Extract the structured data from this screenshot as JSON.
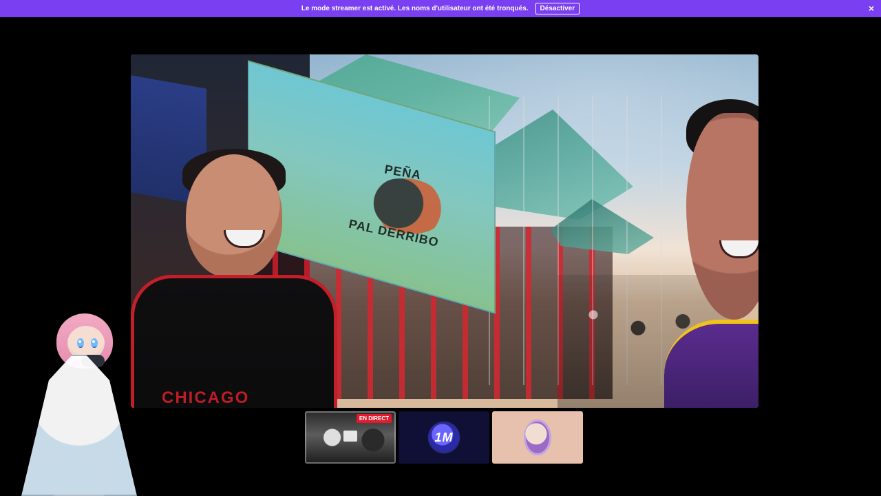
{
  "banner": {
    "message": "Le mode streamer est activé. Les noms d'utilisateur ont été tronqués.",
    "button_label": "Désactiver",
    "close_glyph": "×"
  },
  "video": {
    "banner_text_top": "PEÑA",
    "banner_text_bottom": "PAL DERRIBO",
    "jersey_text": "CHICAGO"
  },
  "thumbnails": {
    "items": [
      {
        "badge": "EN DIRECT",
        "icon": "screen-share-icon"
      },
      {
        "logo_text": "1M"
      },
      {
        "icon": "avatar-icon"
      }
    ]
  },
  "colors": {
    "banner_bg": "#7a3ff0",
    "live_badge": "#e11b2e"
  }
}
